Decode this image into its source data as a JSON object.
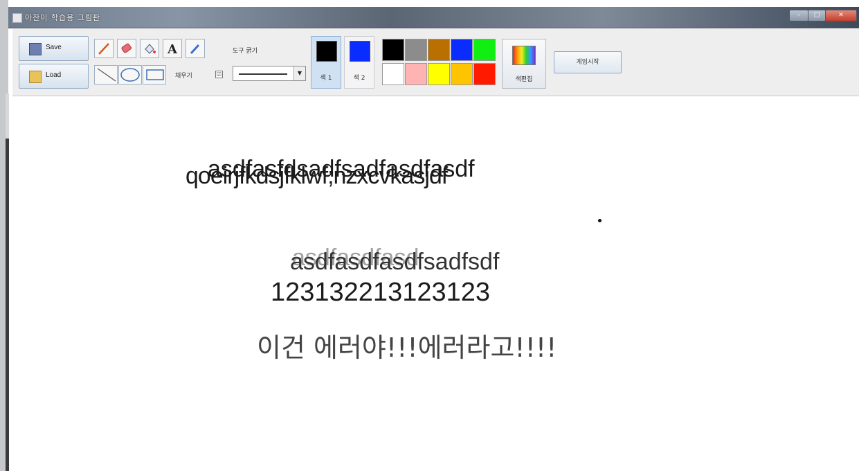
{
  "window": {
    "title": "아찬이 학습용 그림판",
    "controls": [
      "minimize",
      "maximize",
      "close"
    ]
  },
  "toolbar": {
    "save_label": "Save",
    "load_label": "Load",
    "tools": [
      "pencil-icon",
      "eraser-icon",
      "fill-icon",
      "text-icon",
      "eyedropper-icon",
      "line-icon",
      "ellipse-icon",
      "rectangle-icon"
    ],
    "text_tool_glyph": "A",
    "fill_label": "채우기",
    "fill_checked": true,
    "fill_check_mark": "☑",
    "thickness_label": "도구 굵기",
    "color1_label": "색 1",
    "color2_label": "색 2",
    "color_edit_label": "색편집",
    "start_game_label": "게임시작"
  },
  "colors": {
    "color1": "#000000",
    "color2": "#0a2cff",
    "palette": [
      [
        "#000000",
        "#8c8c8c",
        "#b97000",
        "#0a2cff",
        "#11ee11"
      ],
      [
        "#ffffff",
        "#ffb3b3",
        "#ffff00",
        "#ffc400",
        "#ff1a00"
      ]
    ]
  },
  "canvas": {
    "texts": [
      "asdfasfdsadfsadfasdfasdf",
      "qoeirjfkdsjfklwf;nzxcvkasjdf",
      "asdfasdfasdfsadfsdf",
      "asdfasdfasd",
      "123132213123123",
      "이건 에러야!!!에러라고!!!!"
    ]
  }
}
